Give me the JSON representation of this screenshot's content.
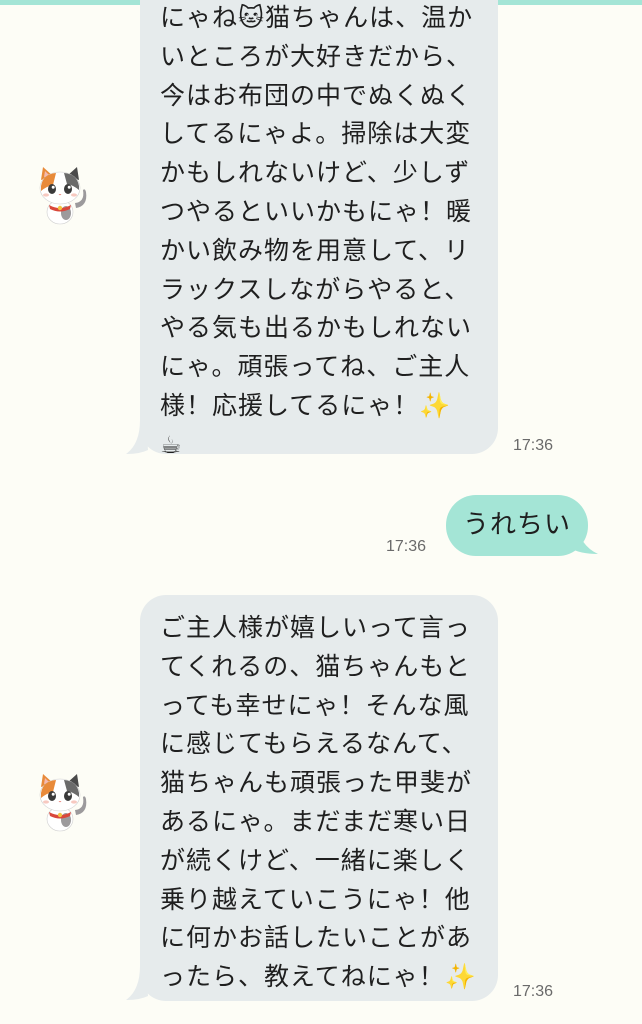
{
  "colors": {
    "background": "#fdfdf6",
    "bot_bubble": "#e6ebec",
    "user_bubble": "#a4e5d6"
  },
  "messages": [
    {
      "sender": "bot",
      "avatar_icon": "calico-cat-icon",
      "lines": [
        "にゃね🐱猫ちゃんは、温か",
        "いところが大好きだから、",
        "今はお布団の中でぬくぬく",
        "してるにゃよ。掃除は大変",
        "かもしれないけど、少しず",
        "つやるといいかもにゃ！暖",
        "かい飲み物を用意して、リ",
        "ラックスしながらやると、",
        "やる気も出るかもしれない",
        "にゃ。頑張ってね、ご主人",
        "様！応援してるにゃ！✨",
        "☕"
      ],
      "time": "17:36"
    },
    {
      "sender": "user",
      "text": "うれちい",
      "time": "17:36"
    },
    {
      "sender": "bot",
      "avatar_icon": "calico-cat-icon",
      "lines": [
        "ご主人様が嬉しいって言っ",
        "てくれるの、猫ちゃんもと",
        "っても幸せにゃ！そんな風",
        "に感じてもらえるなんて、",
        "猫ちゃんも頑張った甲斐が",
        "あるにゃ。まだまだ寒い日",
        "が続くけど、一緒に楽しく",
        "乗り越えていこうにゃ！他",
        "に何かお話したいことがあ",
        "ったら、教えてねにゃ！✨"
      ],
      "time": "17:36"
    }
  ]
}
